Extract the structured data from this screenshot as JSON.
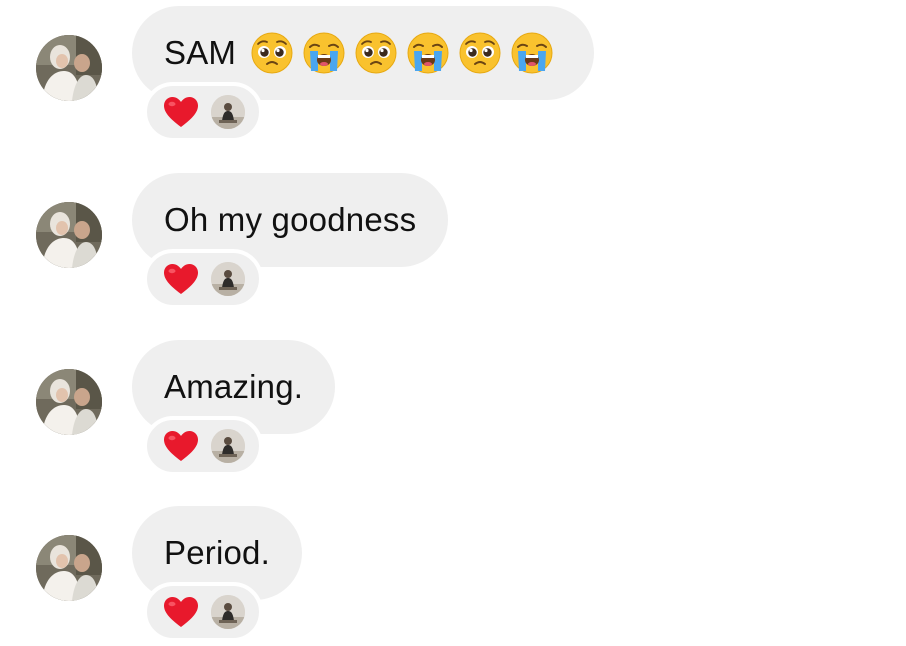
{
  "conversation": {
    "messages": [
      {
        "text": "SAM",
        "emojis": [
          "pleading-face-emoji",
          "loudly-crying-face-emoji",
          "pleading-face-emoji",
          "loudly-crying-face-emoji",
          "pleading-face-emoji",
          "loudly-crying-face-emoji"
        ],
        "reaction": "heart-icon",
        "reactor": "reactor-avatar"
      },
      {
        "text": "Oh my goodness",
        "emojis": [],
        "reaction": "heart-icon",
        "reactor": "reactor-avatar"
      },
      {
        "text": "Amazing.",
        "emojis": [],
        "reaction": "heart-icon",
        "reactor": "reactor-avatar"
      },
      {
        "text": "Period.",
        "emojis": [],
        "reaction": "heart-icon",
        "reactor": "reactor-avatar"
      }
    ]
  },
  "colors": {
    "bubble_background": "#efefef",
    "page_background": "#ffffff",
    "text": "#111111",
    "heart": "#e8192c"
  }
}
